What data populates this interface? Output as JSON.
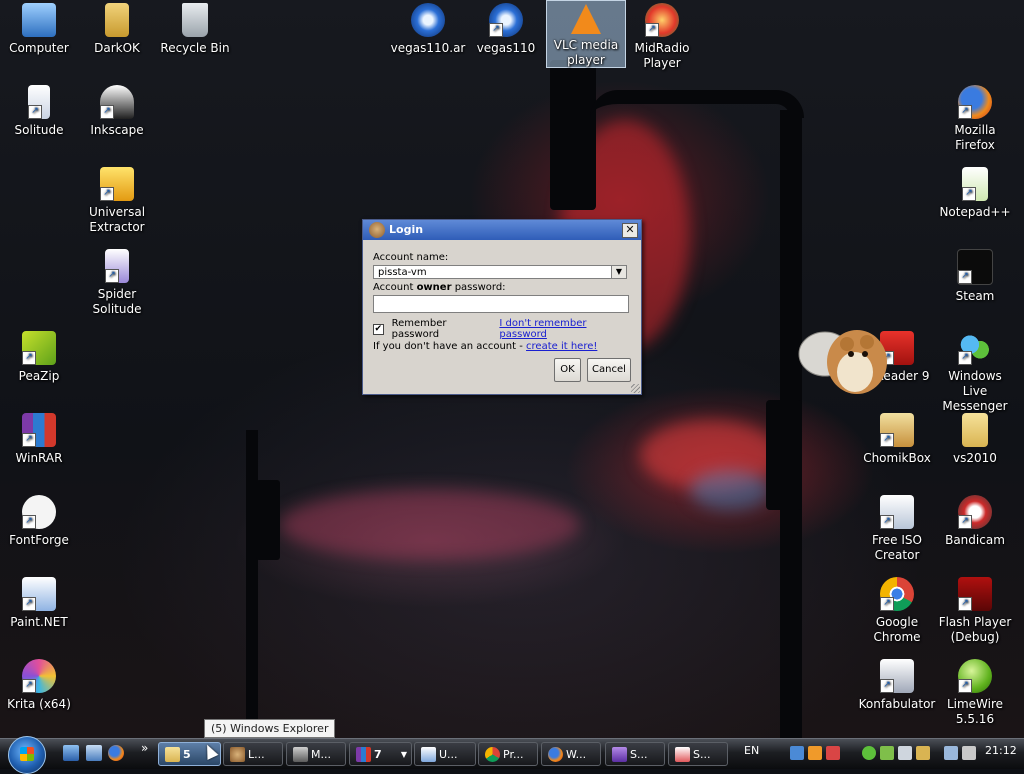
{
  "desktop": {
    "icons": [
      {
        "label": "Computer"
      },
      {
        "label": "DarkOK"
      },
      {
        "label": "Recycle Bin"
      },
      {
        "label": "vegas110.ar"
      },
      {
        "label": "vegas110"
      },
      {
        "label": "VLC media player"
      },
      {
        "label": "MidRadio Player"
      },
      {
        "label": "Solitude"
      },
      {
        "label": "Inkscape"
      },
      {
        "label": "Universal Extractor"
      },
      {
        "label": "Spider Solitude"
      },
      {
        "label": "PeaZip"
      },
      {
        "label": "WinRAR"
      },
      {
        "label": "FontForge"
      },
      {
        "label": "Paint.NET"
      },
      {
        "label": "Krita (x64)"
      },
      {
        "label": "Mozilla Firefox"
      },
      {
        "label": "Notepad++"
      },
      {
        "label": "Steam"
      },
      {
        "label": "e Reader 9"
      },
      {
        "label": "Windows Live Messenger"
      },
      {
        "label": "ChomikBox"
      },
      {
        "label": "vs2010"
      },
      {
        "label": "Free ISO Creator"
      },
      {
        "label": "Bandicam"
      },
      {
        "label": "Google Chrome"
      },
      {
        "label": "Flash Player (Debug)"
      },
      {
        "label": "Konfabulator"
      },
      {
        "label": "LimeWire 5.5.16"
      }
    ]
  },
  "dialog": {
    "title": "Login",
    "account_name_label": "Account name:",
    "account_name_value": "pissta-vm",
    "password_label_prefix": "Account ",
    "password_label_bold": "owner",
    "password_label_suffix": " password:",
    "password_value": "",
    "remember_label": "Remember password",
    "remember_checked": true,
    "forgot_link": "I don't remember password",
    "no_account_text": "If you don't have an account - ",
    "create_link": "create it here!",
    "ok_label": "OK",
    "cancel_label": "Cancel",
    "close_glyph": "✕"
  },
  "tooltip": "(5) Windows Explorer",
  "taskbar": {
    "buttons": [
      {
        "label": "5",
        "icon": "folder-icon"
      },
      {
        "label": "L...",
        "icon": "login-app-icon"
      },
      {
        "label": "M...",
        "icon": "media-icon"
      },
      {
        "label": "7",
        "icon": "winrar-icon"
      },
      {
        "label": "U...",
        "icon": "window-icon"
      },
      {
        "label": "Pr...",
        "icon": "chrome-icon"
      },
      {
        "label": "W...",
        "icon": "firefox-icon"
      },
      {
        "label": "S...",
        "icon": "vs-icon"
      },
      {
        "label": "S...",
        "icon": "app-icon"
      }
    ],
    "language": "EN",
    "clock": "21:12",
    "chevron": "»"
  }
}
